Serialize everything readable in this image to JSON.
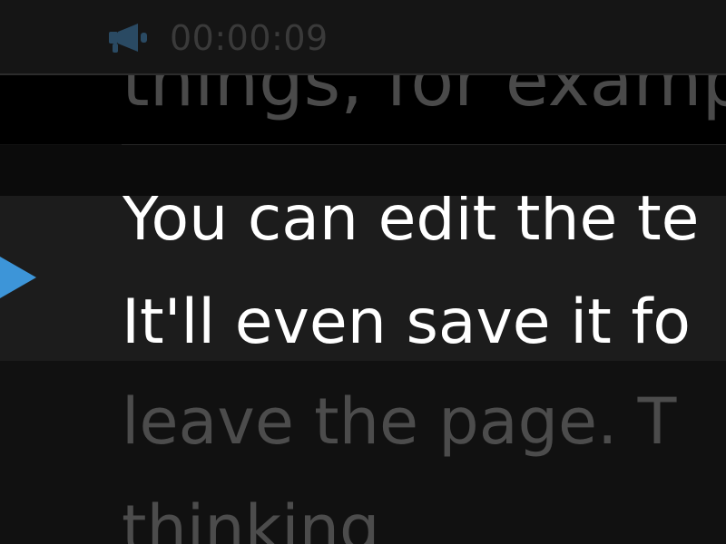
{
  "status_bar": {
    "icon": "megaphone-icon",
    "timer": "00:00:09",
    "icon_color": "#2a4a63"
  },
  "transcript": {
    "previous_line": "things, for exampl",
    "active_lines": [
      "You can edit the te",
      "It'll even save it fo"
    ],
    "next_lines": [
      "leave the page.   T",
      "thinking"
    ],
    "accent_color": "#3d95d8"
  }
}
